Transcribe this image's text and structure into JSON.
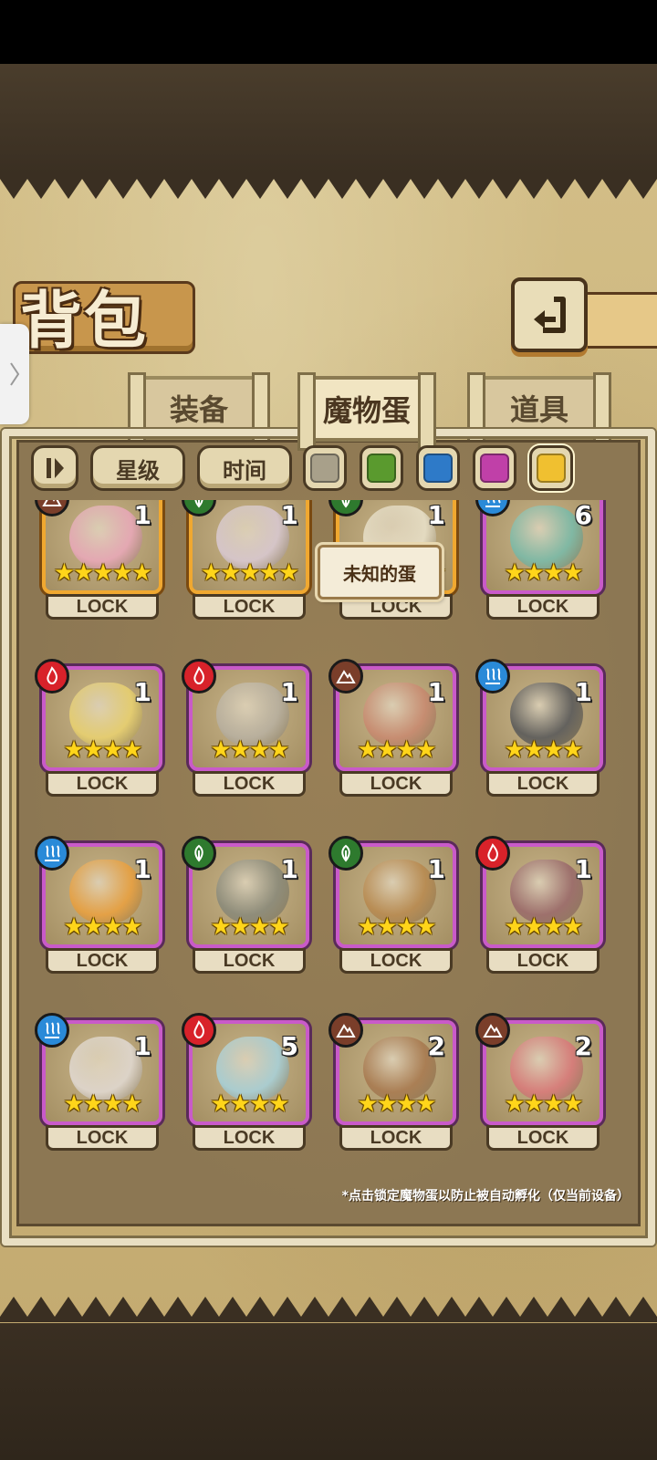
{
  "screen": {
    "title": "背包"
  },
  "tabs": [
    {
      "label": "装备",
      "active": false
    },
    {
      "label": "魔物蛋",
      "active": true
    },
    {
      "label": "道具",
      "active": false
    }
  ],
  "filters": {
    "sort_icon": "sort-toggle-icon",
    "star_label": "星级",
    "time_label": "时间",
    "rarity_colors": [
      {
        "name": "gray",
        "color": "#a8a08a"
      },
      {
        "name": "green",
        "color": "#5a9a2e"
      },
      {
        "name": "blue",
        "color": "#2e7ac8"
      },
      {
        "name": "purple",
        "color": "#c040a8"
      },
      {
        "name": "gold",
        "color": "#f0c030"
      }
    ],
    "selected_color": "gold"
  },
  "tooltip": "未知的蛋",
  "eggs": [
    {
      "element": "earth",
      "count": "1",
      "stars": 5,
      "rarity": "gold",
      "lock": "LOCK",
      "art": "#e8a8b8"
    },
    {
      "element": "leaf",
      "count": "1",
      "stars": 5,
      "rarity": "gold",
      "lock": "LOCK",
      "art": "#d8c8d0"
    },
    {
      "element": "leaf",
      "count": "1",
      "stars": 5,
      "rarity": "gold",
      "lock": "LOCK",
      "art": "#e8e0c8"
    },
    {
      "element": "water",
      "count": "6",
      "stars": 4,
      "rarity": "purple",
      "lock": "LOCK",
      "art": "#7abaa8"
    },
    {
      "element": "fire",
      "count": "1",
      "stars": 4,
      "rarity": "purple",
      "lock": "LOCK",
      "art": "#e8d070"
    },
    {
      "element": "fire",
      "count": "1",
      "stars": 4,
      "rarity": "purple",
      "lock": "LOCK",
      "art": "#b8b0a0"
    },
    {
      "element": "earth",
      "count": "1",
      "stars": 4,
      "rarity": "purple",
      "lock": "LOCK",
      "art": "#c88a70"
    },
    {
      "element": "water",
      "count": "1",
      "stars": 4,
      "rarity": "purple",
      "lock": "LOCK",
      "art": "#5a5a5a"
    },
    {
      "element": "water",
      "count": "1",
      "stars": 4,
      "rarity": "purple",
      "lock": "LOCK",
      "art": "#e8a040"
    },
    {
      "element": "leaf",
      "count": "1",
      "stars": 4,
      "rarity": "purple",
      "lock": "LOCK",
      "art": "#8a8a7a"
    },
    {
      "element": "leaf",
      "count": "1",
      "stars": 4,
      "rarity": "purple",
      "lock": "LOCK",
      "art": "#b88a50"
    },
    {
      "element": "fire",
      "count": "1",
      "stars": 4,
      "rarity": "purple",
      "lock": "LOCK",
      "art": "#9a6a6a"
    },
    {
      "element": "water",
      "count": "1",
      "stars": 4,
      "rarity": "purple",
      "lock": "LOCK",
      "art": "#e0d8d0"
    },
    {
      "element": "fire",
      "count": "5",
      "stars": 4,
      "rarity": "purple",
      "lock": "LOCK",
      "art": "#a8d0d8"
    },
    {
      "element": "earth",
      "count": "2",
      "stars": 4,
      "rarity": "purple",
      "lock": "LOCK",
      "art": "#a87a50"
    },
    {
      "element": "earth",
      "count": "2",
      "stars": 4,
      "rarity": "purple",
      "lock": "LOCK",
      "art": "#d87a7a"
    }
  ],
  "footnote": "*点击锁定魔物蛋以防止被自动孵化（仅当前设备）"
}
